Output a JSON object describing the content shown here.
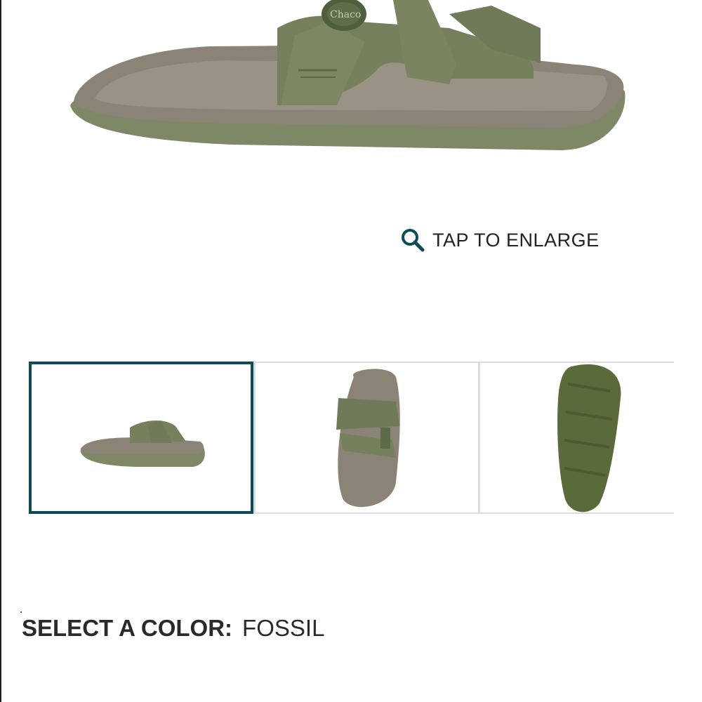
{
  "gallery": {
    "enlarge_label": "TAP TO ENLARGE",
    "enlarge_icon": "magnifier-icon",
    "thumbnails": [
      {
        "view": "side",
        "selected": true
      },
      {
        "view": "top",
        "selected": false
      },
      {
        "view": "sole",
        "selected": false
      }
    ]
  },
  "color_selector": {
    "label": "SELECT A COLOR:",
    "value": "FOSSIL"
  },
  "colors": {
    "accent": "#0e4b57",
    "strap": "#6f7a58",
    "footbed": "#8a8173",
    "sole": "#7f8b68"
  }
}
